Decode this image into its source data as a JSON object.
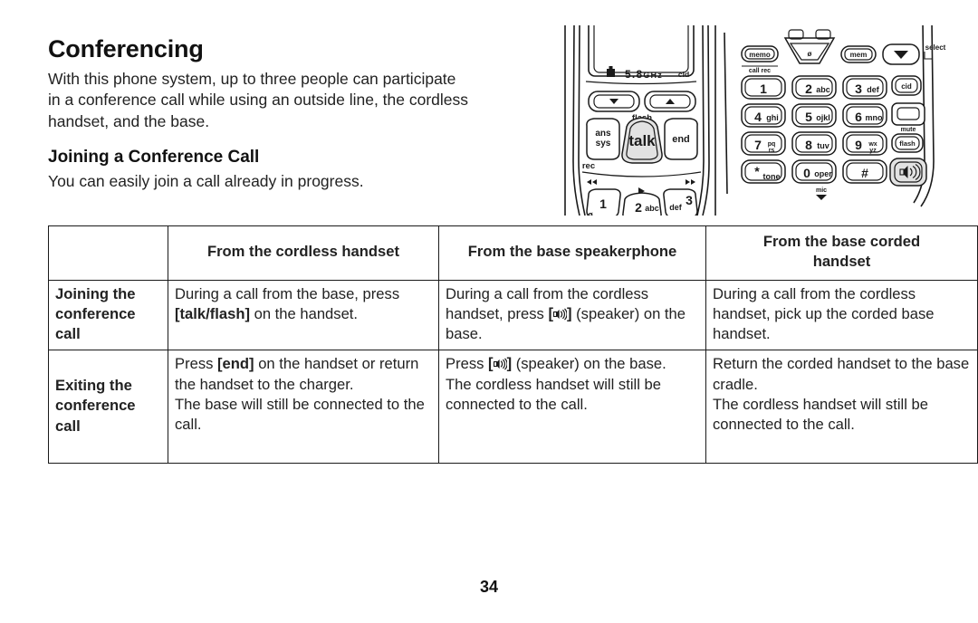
{
  "document": {
    "heading": "Conferencing",
    "intro_lines": [
      "With this phone system, up to three people can participate",
      "in a conference call while using an outside line, the cordless",
      "handset, and the base."
    ],
    "sub_heading": "Joining a Conference Call",
    "sub_body": "You can easily join a call already in progress.",
    "page_number": "34"
  },
  "table": {
    "headers": {
      "corner": "",
      "cordless_handset": "From the cordless handset",
      "base_speakerphone": "From the base speakerphone",
      "base_corded_handset_line1": "From the base corded",
      "base_corded_handset_line2": "handset"
    },
    "rows": [
      {
        "label_lines": [
          "Joining the",
          "conference",
          "call"
        ],
        "cordless_handset": {
          "before": "During a call from the base,",
          "press_prefix": "press ",
          "key": "[talk/flash]",
          "after": " on the handset."
        },
        "base_speakerphone": {
          "before": "During a call from the cordless handset, press ",
          "icon": "speaker-icon",
          "after": " (speaker) on the base."
        },
        "base_corded_handset": "During a call from the cordless handset, pick up the corded base handset."
      },
      {
        "label_lines": [
          "Exiting the",
          "conference",
          "call"
        ],
        "cordless_handset": {
          "press_prefix": "Press ",
          "key": "[end]",
          "after": " on the handset or return the handset to the charger.",
          "second": "The base will still be connected to the call."
        },
        "base_speakerphone": {
          "press_prefix": "Press ",
          "icon": "speaker-icon",
          "after": " (speaker) on the base.",
          "second": "The cordless handset will still be connected to the call."
        },
        "base_corded_handset": {
          "first": "Return the corded handset to the base cradle.",
          "second": "The cordless handset will still be connected to the call."
        }
      }
    ]
  },
  "illustration": {
    "handset": {
      "display_freq": "5.8GHz",
      "display_cid": "cid",
      "label_flash": "flash",
      "button_ans_sys_line1": "ans",
      "button_ans_sys_line2": "sys",
      "button_talk": "talk",
      "button_end": "end",
      "label_rec": "rec",
      "key_1": "1",
      "key_2_digit": "2",
      "key_2_letters": "abc",
      "key_3_digit": "3",
      "key_3_letters": "def",
      "label_slash_o": "ø"
    },
    "base": {
      "button_memo": "memo",
      "label_call_rec": "call rec",
      "button_mem": "mem",
      "label_select": "select",
      "label_slash_o": "ø",
      "keys": [
        {
          "digit": "1",
          "letters": ""
        },
        {
          "digit": "2",
          "letters": "abc"
        },
        {
          "digit": "3",
          "letters": "def"
        },
        {
          "digit": "4",
          "letters": "ghi"
        },
        {
          "digit": "5",
          "letters": "ojkl"
        },
        {
          "digit": "6",
          "letters": "mno"
        },
        {
          "digit": "7",
          "letters": "pq\nrs"
        },
        {
          "digit": "8",
          "letters": "tuv"
        },
        {
          "digit": "9",
          "letters": "wx\nyz"
        },
        {
          "digit": "*",
          "letters": "tone"
        },
        {
          "digit": "0",
          "letters": "oper"
        },
        {
          "digit": "#",
          "letters": ""
        }
      ],
      "button_cid": "cid",
      "label_mute": "mute",
      "button_flash": "flash",
      "label_mic": "mic"
    }
  },
  "colors": {
    "ink": "#1a1a1a",
    "text": "#222222",
    "page_bg": "#ffffff",
    "key_fill": "#e2e2e2",
    "display_fill": "#ffffff"
  }
}
